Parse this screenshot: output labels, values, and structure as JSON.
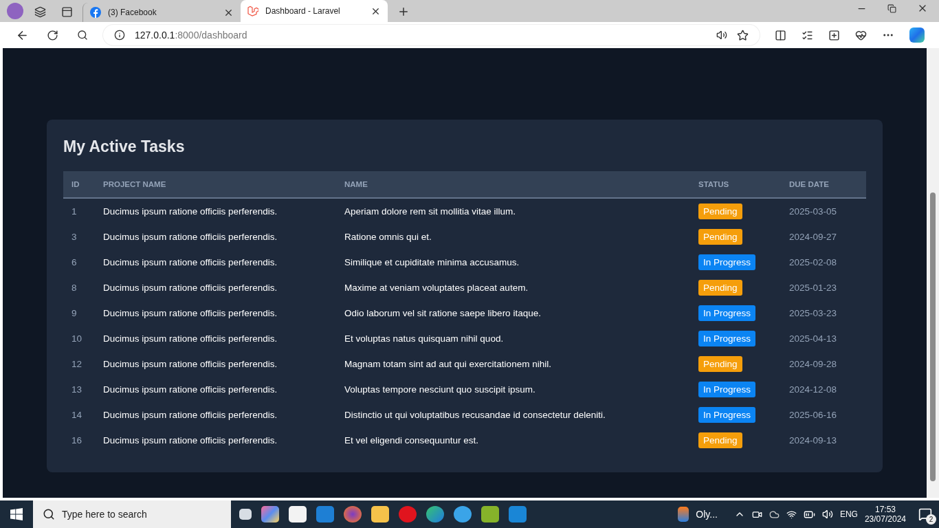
{
  "browser": {
    "tabs": [
      {
        "title": "(3) Facebook",
        "kind": "facebook",
        "selected": false
      },
      {
        "title": "Dashboard - Laravel",
        "kind": "laravel",
        "selected": true
      }
    ],
    "address": {
      "host": "127.0.0.1",
      "path": ":8000/dashboard"
    }
  },
  "card": {
    "title": "My Active Tasks",
    "columns": [
      "ID",
      "PROJECT NAME",
      "NAME",
      "STATUS",
      "DUE DATE"
    ],
    "rows": [
      {
        "id": "1",
        "project": "Ducimus ipsum ratione officiis perferendis.",
        "name": "Aperiam dolore rem sit mollitia vitae illum.",
        "status": {
          "label": "Pending",
          "kind": "pending"
        },
        "due": "2025-03-05"
      },
      {
        "id": "3",
        "project": "Ducimus ipsum ratione officiis perferendis.",
        "name": "Ratione omnis qui et.",
        "status": {
          "label": "Pending",
          "kind": "pending"
        },
        "due": "2024-09-27"
      },
      {
        "id": "6",
        "project": "Ducimus ipsum ratione officiis perferendis.",
        "name": "Similique et cupiditate minima accusamus.",
        "status": {
          "label": "In Progress",
          "kind": "progress"
        },
        "due": "2025-02-08"
      },
      {
        "id": "8",
        "project": "Ducimus ipsum ratione officiis perferendis.",
        "name": "Maxime at veniam voluptates placeat autem.",
        "status": {
          "label": "Pending",
          "kind": "pending"
        },
        "due": "2025-01-23"
      },
      {
        "id": "9",
        "project": "Ducimus ipsum ratione officiis perferendis.",
        "name": "Odio laborum vel sit ratione saepe libero itaque.",
        "status": {
          "label": "In Progress",
          "kind": "progress"
        },
        "due": "2025-03-23"
      },
      {
        "id": "10",
        "project": "Ducimus ipsum ratione officiis perferendis.",
        "name": "Et voluptas natus quisquam nihil quod.",
        "status": {
          "label": "In Progress",
          "kind": "progress"
        },
        "due": "2025-04-13"
      },
      {
        "id": "12",
        "project": "Ducimus ipsum ratione officiis perferendis.",
        "name": "Magnam totam sint ad aut qui exercitationem nihil.",
        "status": {
          "label": "Pending",
          "kind": "pending"
        },
        "due": "2024-09-28"
      },
      {
        "id": "13",
        "project": "Ducimus ipsum ratione officiis perferendis.",
        "name": "Voluptas tempore nesciunt quo suscipit ipsum.",
        "status": {
          "label": "In Progress",
          "kind": "progress"
        },
        "due": "2024-12-08"
      },
      {
        "id": "14",
        "project": "Ducimus ipsum ratione officiis perferendis.",
        "name": "Distinctio ut qui voluptatibus recusandae id consectetur deleniti.",
        "status": {
          "label": "In Progress",
          "kind": "progress"
        },
        "due": "2025-06-16"
      },
      {
        "id": "16",
        "project": "Ducimus ipsum ratione officiis perferendis.",
        "name": "Et vel eligendi consequuntur est.",
        "status": {
          "label": "Pending",
          "kind": "pending"
        },
        "due": "2024-09-13"
      }
    ]
  },
  "taskbar": {
    "search": {
      "placeholder": "Type here to search"
    },
    "app_label": "Oly...",
    "language": "ENG",
    "time": "17:53",
    "date": "23/07/2024",
    "notifications": "2"
  }
}
